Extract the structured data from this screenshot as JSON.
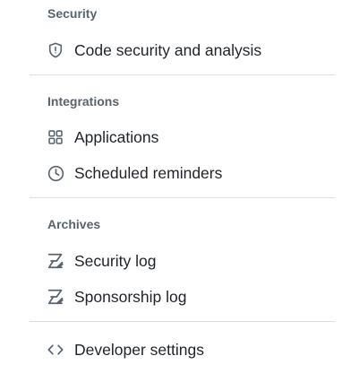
{
  "sections": {
    "security": {
      "heading": "Security",
      "items": [
        {
          "label": "Code security and analysis",
          "icon": "shield-icon"
        }
      ]
    },
    "integrations": {
      "heading": "Integrations",
      "items": [
        {
          "label": "Applications",
          "icon": "apps-grid-icon"
        },
        {
          "label": "Scheduled reminders",
          "icon": "clock-icon"
        }
      ]
    },
    "archives": {
      "heading": "Archives",
      "items": [
        {
          "label": "Security log",
          "icon": "log-icon"
        },
        {
          "label": "Sponsorship log",
          "icon": "log-icon"
        }
      ]
    },
    "developer": {
      "items": [
        {
          "label": "Developer settings",
          "icon": "code-icon"
        }
      ]
    }
  },
  "colors": {
    "text": "#1f2328",
    "muted": "#59636e",
    "divider": "#d8dee4"
  }
}
